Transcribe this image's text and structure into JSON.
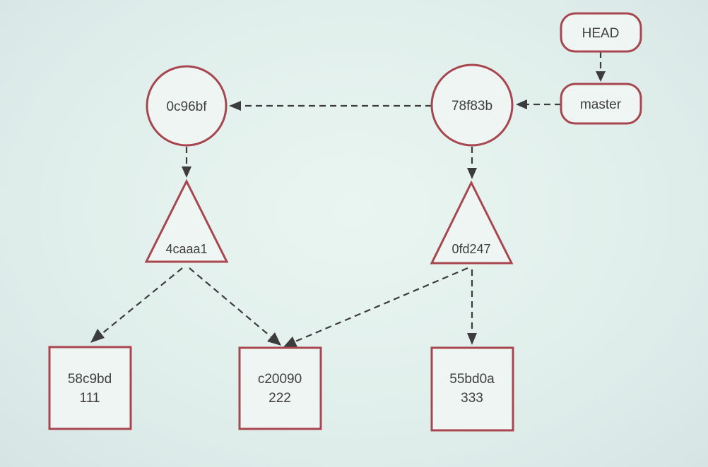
{
  "nodes": {
    "head": {
      "label": "HEAD",
      "kind": "ref"
    },
    "master": {
      "label": "master",
      "kind": "branch"
    },
    "commit_78f83b": {
      "label": "78f83b",
      "kind": "commit"
    },
    "commit_0c96bf": {
      "label": "0c96bf",
      "kind": "commit"
    },
    "tree_4caaa1": {
      "label": "4caaa1",
      "kind": "tree"
    },
    "tree_0fd247": {
      "label": "0fd247",
      "kind": "tree"
    },
    "blob_58c9bd": {
      "hash": "58c9bd",
      "content": "111",
      "kind": "blob"
    },
    "blob_c20090": {
      "hash": "c20090",
      "content": "222",
      "kind": "blob"
    },
    "blob_55bd0a": {
      "hash": "55bd0a",
      "content": "333",
      "kind": "blob"
    }
  },
  "edges": [
    {
      "from": "head",
      "to": "master"
    },
    {
      "from": "master",
      "to": "commit_78f83b"
    },
    {
      "from": "commit_78f83b",
      "to": "commit_0c96bf"
    },
    {
      "from": "commit_0c96bf",
      "to": "tree_4caaa1"
    },
    {
      "from": "commit_78f83b",
      "to": "tree_0fd247"
    },
    {
      "from": "tree_4caaa1",
      "to": "blob_58c9bd"
    },
    {
      "from": "tree_4caaa1",
      "to": "blob_c20090"
    },
    {
      "from": "tree_0fd247",
      "to": "blob_c20090"
    },
    {
      "from": "tree_0fd247",
      "to": "blob_55bd0a"
    }
  ],
  "colors": {
    "node_outline": "#a8464f",
    "edge": "#3c3c3c",
    "text": "#3f3f3f"
  }
}
